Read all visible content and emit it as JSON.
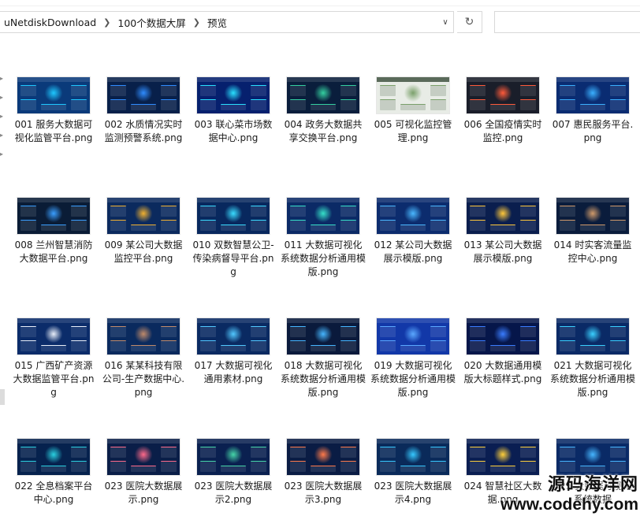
{
  "breadcrumbs": [
    "uNetdiskDownload",
    "100个数据大屏",
    "预览"
  ],
  "icons": {
    "crumb_separator": "chevron-right-icon",
    "address_dropdown": "chevron-down-icon",
    "refresh": "refresh-icon",
    "nav_expand": "chevron-right-icon"
  },
  "files": [
    {
      "label": "001 服务大数据可视化监管平台.png",
      "theme": "#0a3a7a",
      "accent": "#1ec8ff"
    },
    {
      "label": "002 水质情况实时监测预警系统.png",
      "theme": "#08204a",
      "accent": "#2f8cff"
    },
    {
      "label": "003 联心菜市场数据中心.png",
      "theme": "#06206e",
      "accent": "#29e0ff"
    },
    {
      "label": "004 政务大数据共享交换平台.png",
      "theme": "#0a1e3c",
      "accent": "#34d0a0"
    },
    {
      "label": "005 可视化监控管理.png",
      "theme": "#e8ece6",
      "accent": "#7aa06a"
    },
    {
      "label": "006 全国疫情实时监控.png",
      "theme": "#1a1e2a",
      "accent": "#ff5a3a"
    },
    {
      "label": "007 惠民服务平台.png",
      "theme": "#0a2c72",
      "accent": "#3ab0ff"
    },
    {
      "label": "008 兰州智慧消防大数据平台.png",
      "theme": "#0a1c36",
      "accent": "#3a9eff"
    },
    {
      "label": "009 某公司大数据监控平台.png",
      "theme": "#0b2a5e",
      "accent": "#f0b030"
    },
    {
      "label": "010 双数智慧公卫-传染病督导平台.png",
      "theme": "#08285e",
      "accent": "#3adcff"
    },
    {
      "label": "011 大数据可视化系统数据分析通用模版.png",
      "theme": "#0b2a66",
      "accent": "#36e0c8"
    },
    {
      "label": "012 某公司大数据展示模版.png",
      "theme": "#0c2c6e",
      "accent": "#4ab8ff"
    },
    {
      "label": "013 某公司大数据展示模版.png",
      "theme": "#0a1e4e",
      "accent": "#ffc83a"
    },
    {
      "label": "014 时实客流量监控中心.png",
      "theme": "#0a1c3c",
      "accent": "#d09a6a"
    },
    {
      "label": "015 广西矿产资源大数据监管平台.png",
      "theme": "#0b2c6a",
      "accent": "#e8eef8"
    },
    {
      "label": "016 某某科技有限公司-生产数据中心.png",
      "theme": "#0a2a5e",
      "accent": "#c08a6a"
    },
    {
      "label": "017 大数据可视化通用素材.png",
      "theme": "#0a2a62",
      "accent": "#52c8ff"
    },
    {
      "label": "018 大数据可视化系统数据分析通用模版.png",
      "theme": "#0a1a3c",
      "accent": "#46b6ff"
    },
    {
      "label": "019 大数据可视化系统数据分析通用模版.png",
      "theme": "#1238a8",
      "accent": "#5aa8ff"
    },
    {
      "label": "020 大数据通用模版大标题样式.png",
      "theme": "#06164a",
      "accent": "#3a7cff"
    },
    {
      "label": "021 大数据可视化系统数据分析通用模版.png",
      "theme": "#0a2a66",
      "accent": "#3ad0ff"
    },
    {
      "label": "022 全息档案平台中心.png",
      "theme": "#06224e",
      "accent": "#2ad0e0"
    },
    {
      "label": "023 医院大数据展示.png",
      "theme": "#0a1e48",
      "accent": "#ff6a8a"
    },
    {
      "label": "023 医院大数据展示2.png",
      "theme": "#0a2050",
      "accent": "#46d6a8"
    },
    {
      "label": "023 医院大数据展示3.png",
      "theme": "#0a1c44",
      "accent": "#ff7a4a"
    },
    {
      "label": "023 医院大数据展示4.png",
      "theme": "#0a2a5a",
      "accent": "#36c8ff"
    },
    {
      "label": "024 智慧社区大数据.png",
      "theme": "#0a1e52",
      "accent": "#ffd03a"
    },
    {
      "label": "025 大数据可视化系统数据",
      "theme": "#0a2a66",
      "accent": "#46b6ff"
    }
  ],
  "watermark": {
    "name": "源码海洋网",
    "url": "www.codehy.com"
  }
}
